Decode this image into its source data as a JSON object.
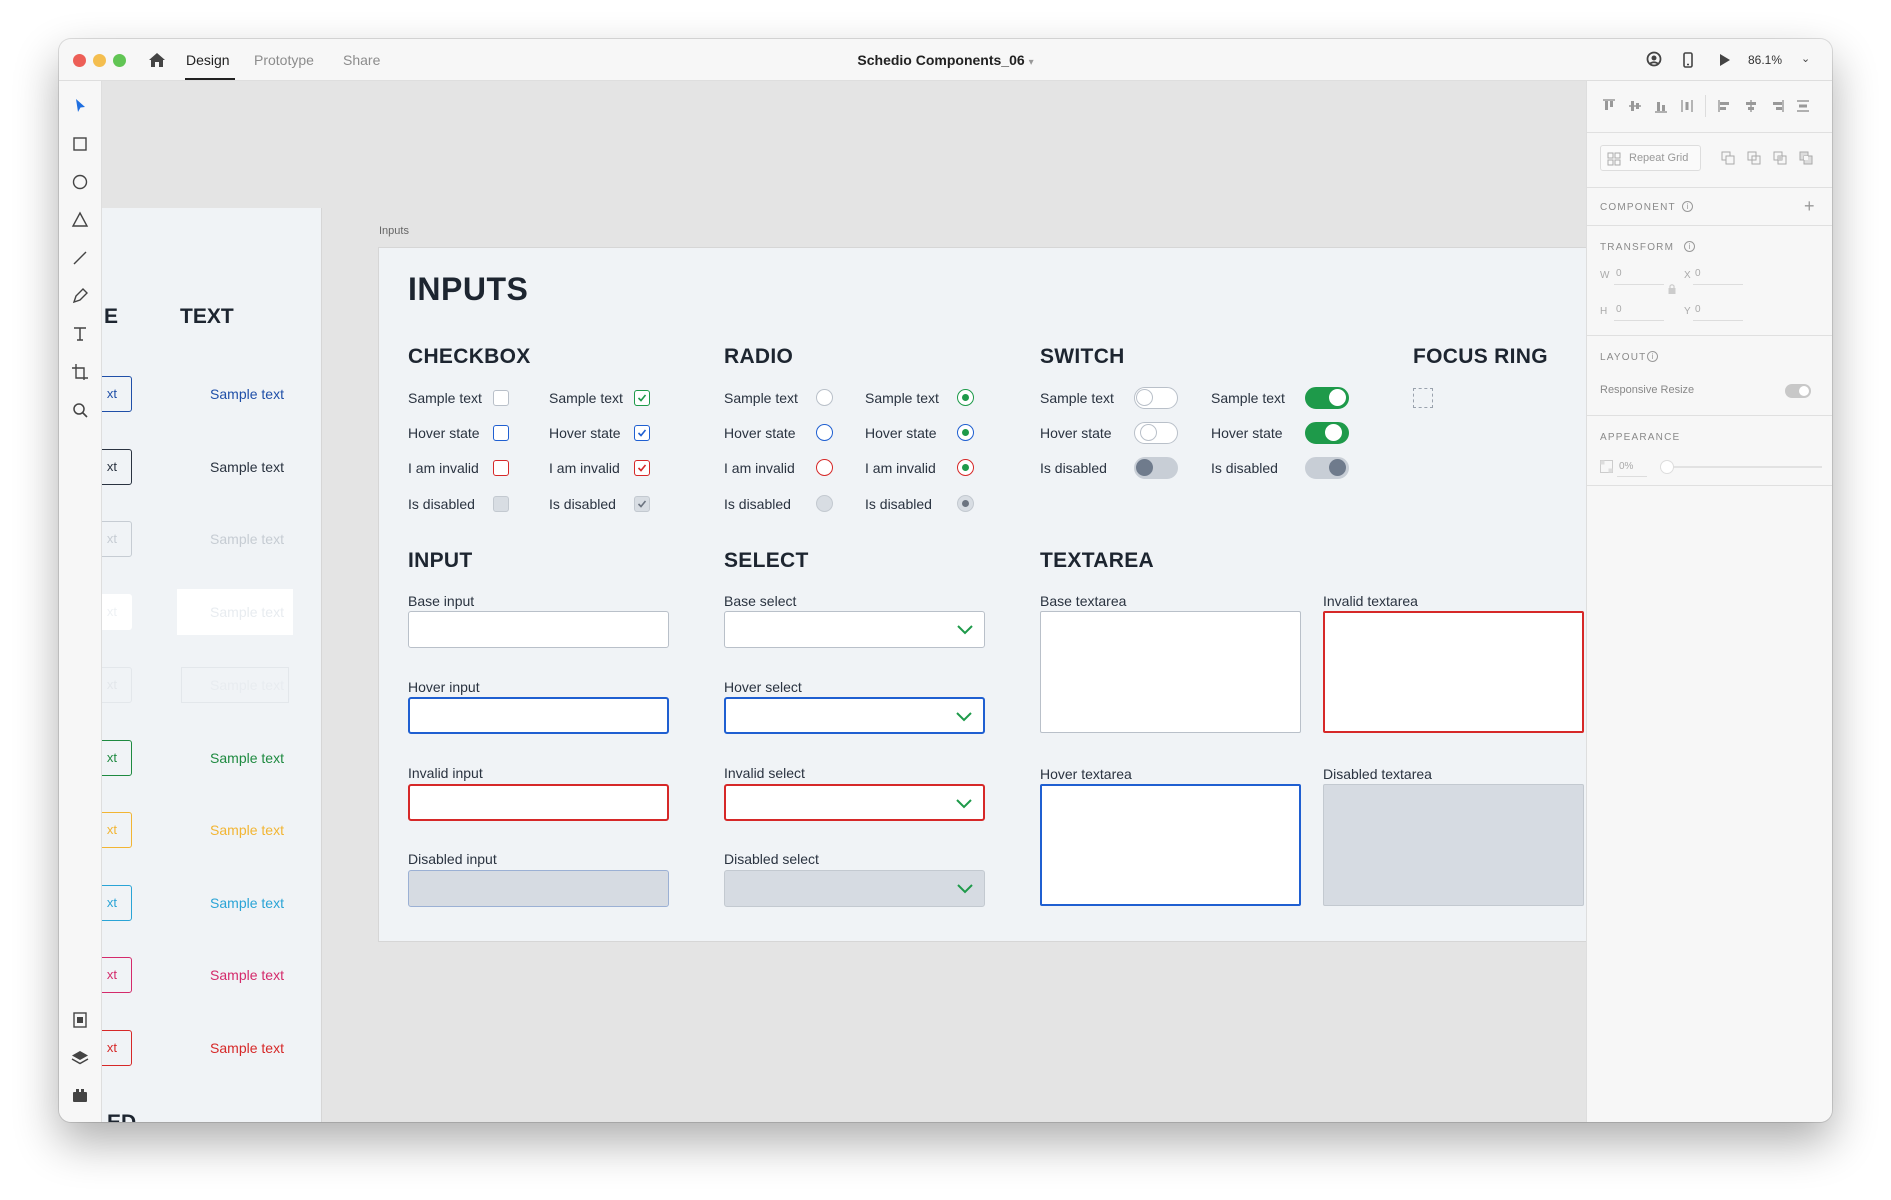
{
  "titlebar": {
    "tabs": [
      "Design",
      "Prototype",
      "Share"
    ],
    "document_title": "Schedio Components_06",
    "zoom": "86.1%",
    "traffic_colors": [
      "#ed5f57",
      "#f4be4f",
      "#61c554"
    ]
  },
  "left_artboard": {
    "headings": [
      "E",
      "TEXT",
      "ED"
    ],
    "button_label": "xt",
    "text_rows": [
      {
        "label": "Sample text",
        "color": "#1f4fa8"
      },
      {
        "label": "Sample text",
        "color": "#2a3340"
      },
      {
        "label": "Sample text",
        "color": "#c6ccd3"
      },
      {
        "label": "Sample text",
        "color": "#e8ecf0"
      },
      {
        "label": "Sample text",
        "color": "#e8ecf0"
      },
      {
        "label": "Sample text",
        "color": "#1e8a40"
      },
      {
        "label": "Sample text",
        "color": "#f2b533"
      },
      {
        "label": "Sample text",
        "color": "#2aa4d6"
      },
      {
        "label": "Sample text",
        "color": "#d42a6b"
      },
      {
        "label": "Sample text",
        "color": "#d62828"
      }
    ]
  },
  "artboard": {
    "label": "Inputs",
    "title": "INPUTS",
    "checkbox": {
      "heading": "CHECKBOX",
      "col1": [
        "Sample text",
        "Hover state",
        "I am invalid",
        "Is disabled"
      ],
      "col2": [
        "Sample text",
        "Hover state",
        "I am invalid",
        "Is disabled"
      ]
    },
    "radio": {
      "heading": "RADIO",
      "col1": [
        "Sample text",
        "Hover state",
        "I am invalid",
        "Is disabled"
      ],
      "col2": [
        "Sample text",
        "Hover state",
        "I am invalid",
        "Is disabled"
      ]
    },
    "switch": {
      "heading": "SWITCH",
      "col1": [
        "Sample text",
        "Hover state",
        "Is disabled"
      ],
      "col2": [
        "Sample text",
        "Hover state",
        "Is disabled"
      ]
    },
    "focus_ring": {
      "heading": "FOCUS RING"
    },
    "input": {
      "heading": "INPUT",
      "labels": [
        "Base input",
        "Hover input",
        "Invalid input",
        "Disabled input"
      ]
    },
    "select": {
      "heading": "SELECT",
      "labels": [
        "Base select",
        "Hover select",
        "Invalid select",
        "Disabled select"
      ]
    },
    "textarea": {
      "heading": "TEXTAREA",
      "labels": [
        "Base textarea",
        "Invalid textarea",
        "Hover textarea",
        "Disabled textarea"
      ]
    }
  },
  "panel": {
    "repeat_grid": "Repeat Grid",
    "component": "COMPONENT",
    "transform": "TRANSFORM",
    "w_label": "W",
    "w_value": "0",
    "x_label": "X",
    "x_value": "0",
    "h_label": "H",
    "h_value": "0",
    "y_label": "Y",
    "y_value": "0",
    "layout": "LAYOUT",
    "responsive_resize": "Responsive Resize",
    "appearance": "APPEARANCE",
    "opacity": "0%"
  },
  "colors": {
    "accent_blue": "#1f5fd1",
    "valid_green": "#1e9a4a",
    "invalid_red": "#d62828"
  }
}
